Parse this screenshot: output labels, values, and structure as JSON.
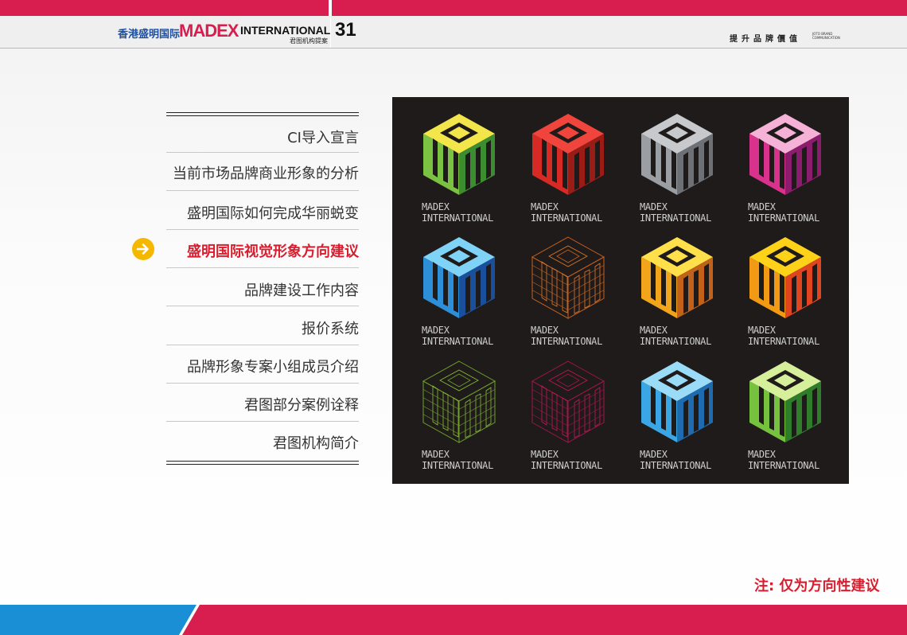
{
  "header": {
    "brand_cn": "香港盛明国际",
    "brand_en": "MADEX",
    "brand_intl": "INTERNATIONAL",
    "brand_sub": "君图机构提案",
    "page_number": "31",
    "tagline": "提升品牌價值",
    "tagline_en": "JOTO BRAND COMMUNICATION"
  },
  "menu": {
    "items": [
      {
        "label": "CI导入宣言"
      },
      {
        "label": "当前市场品牌商业形象的分析"
      },
      {
        "label": "盛明国际如何完成华丽蜕变"
      },
      {
        "label": "盛明国际视觉形象方向建议",
        "active": true
      },
      {
        "label": "品牌建设工作内容"
      },
      {
        "label": "报价系统"
      },
      {
        "label": "品牌形象专案小组成员介绍"
      },
      {
        "label": "君图部分案例诠释"
      },
      {
        "label": "君图机构简介"
      }
    ]
  },
  "logos": [
    {
      "line1": "MADEX",
      "line2": "INTERNATIONAL",
      "style": "green-yellow"
    },
    {
      "line1": "MADEX",
      "line2": "INTERNATIONAL",
      "style": "red"
    },
    {
      "line1": "MADEX",
      "line2": "INTERNATIONAL",
      "style": "gray"
    },
    {
      "line1": "MADEX",
      "line2": "INTERNATIONAL",
      "style": "pink-magenta"
    },
    {
      "line1": "MADEX",
      "line2": "INTERNATIONAL",
      "style": "blue"
    },
    {
      "line1": "MADEX",
      "line2": "INTERNATIONAL",
      "style": "orange-wireframe"
    },
    {
      "line1": "MADEX",
      "line2": "INTERNATIONAL",
      "style": "yellow-orange-mosaic"
    },
    {
      "line1": "MADEX",
      "line2": "INTERNATIONAL",
      "style": "orange-gradient"
    },
    {
      "line1": "MADEX",
      "line2": "INTERNATIONAL",
      "style": "green-wireframe"
    },
    {
      "line1": "MADEX",
      "line2": "INTERNATIONAL",
      "style": "magenta-wireframe"
    },
    {
      "line1": "MADEX",
      "line2": "INTERNATIONAL",
      "style": "sky-blue"
    },
    {
      "line1": "MADEX",
      "line2": "INTERNATIONAL",
      "style": "green-gradient"
    }
  ],
  "note": "注: 仅为方向性建议",
  "colors": {
    "accent_red": "#d81e4e",
    "accent_blue": "#1a8fd6",
    "brand_blue": "#1d4fa0",
    "arrow_yellow": "#f5b800",
    "panel_bg": "#1f1b1a"
  },
  "icons": {
    "current_item_marker": "arrow-right-circle-icon"
  }
}
